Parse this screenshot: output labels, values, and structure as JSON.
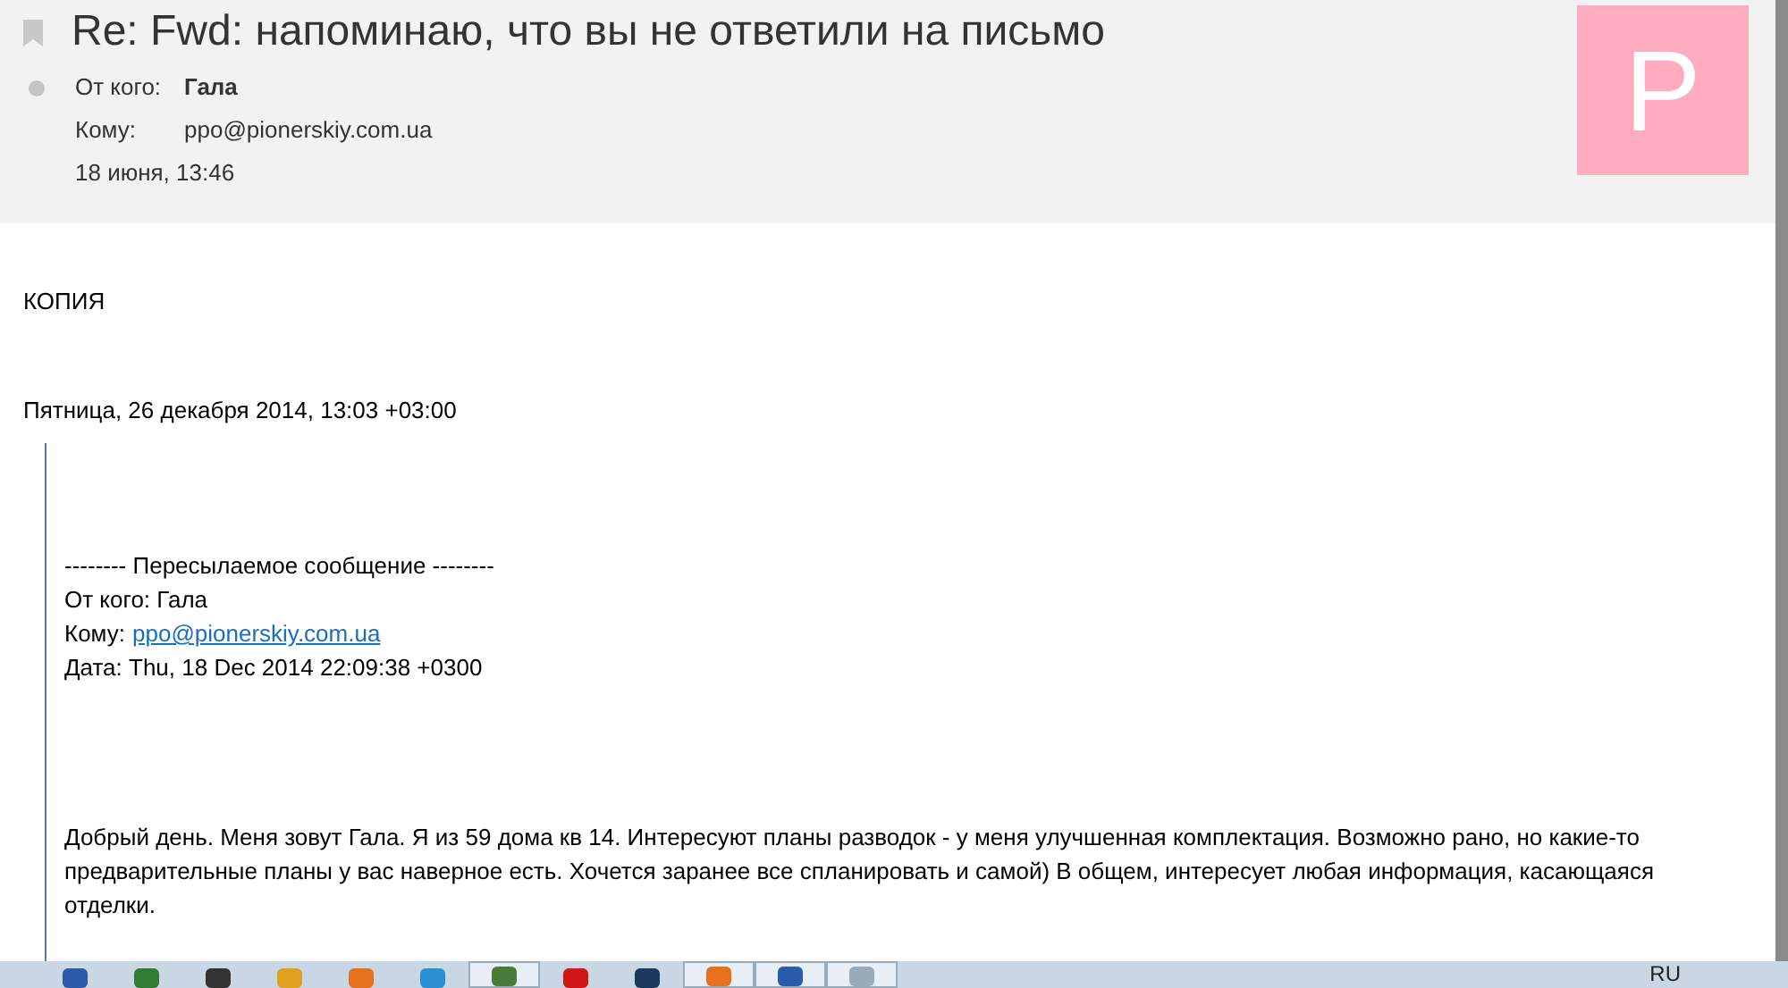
{
  "message": {
    "subject": "Re: Fwd: напоминаю, что вы не ответили на письмо",
    "from_label": "От кого:",
    "from": "Гала",
    "to_label": "Кому:",
    "to": "ppo@pionerskiy.com.ua",
    "date": "18 июня, 13:46",
    "avatar_letter": "P"
  },
  "body": {
    "copy_label": "КОПИЯ",
    "sent": "Пятница, 26 декабря 2014, 13:03 +03:00",
    "quote": {
      "separator": "-------- Пересылаемое сообщение --------",
      "from": "От кого: Гала",
      "to_label": "Кому:",
      "to_link": "ppo@pionerskiy.com.ua",
      "date": "Дата: Thu, 18 Dec 2014 22:09:38 +0300",
      "text": "Добрый день. Меня зовут Гала. Я из 59 дома кв 14. Интересуют планы разводок - у меня улучшенная комплектация. Возможно рано, но какие-то предварительные планы у вас наверное есть. Хочется заранее все спланировать и самой) В общем, интересует любая информация, касающаяся отделки."
    }
  },
  "taskbar": {
    "language": "RU"
  }
}
